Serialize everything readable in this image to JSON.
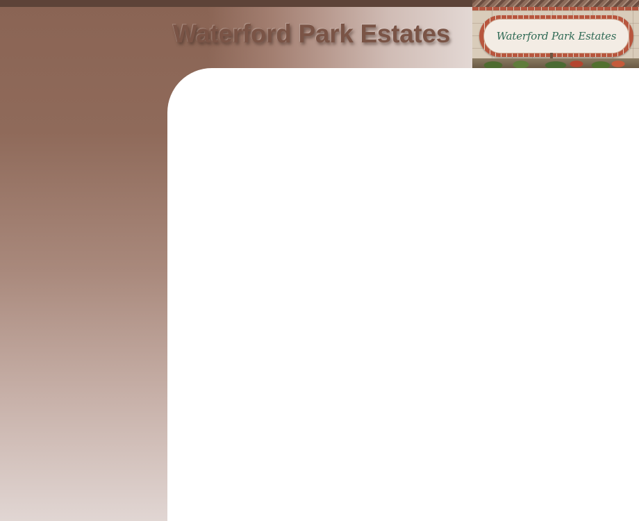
{
  "site": {
    "title": "Waterford Park Estates",
    "sign_text": "Waterford Park Estates"
  },
  "colors": {
    "brand_brown": "#8a6454",
    "title_text": "#7a5446",
    "top_bar": "#5d4338",
    "content_background": "#ffffff",
    "sign_lettering": "#2f6a55"
  },
  "images": {
    "header_photo": "entrance-sign-photo"
  }
}
